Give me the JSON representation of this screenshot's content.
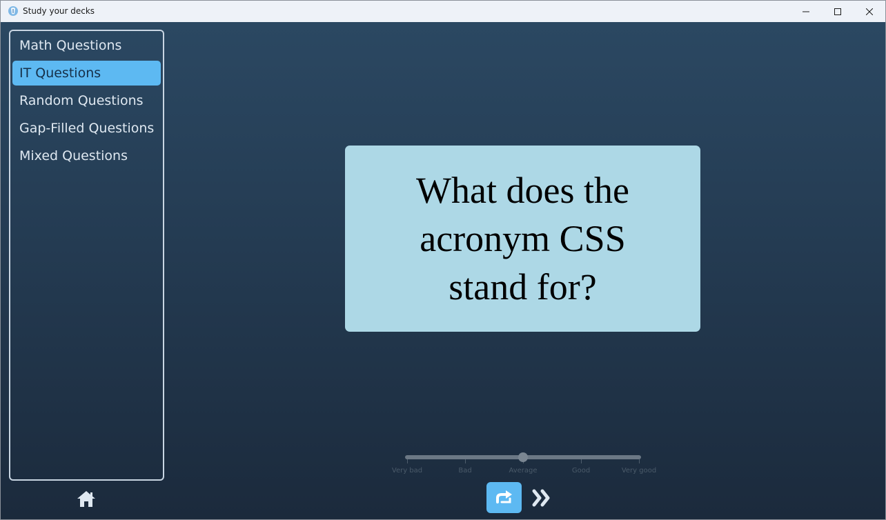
{
  "window": {
    "title": "Study your decks"
  },
  "sidebar": {
    "items": [
      {
        "label": "Math Questions",
        "selected": false
      },
      {
        "label": "IT Questions",
        "selected": true
      },
      {
        "label": "Random Questions",
        "selected": false
      },
      {
        "label": "Gap-Filled Questions",
        "selected": false
      },
      {
        "label": "Mixed Questions",
        "selected": false
      }
    ]
  },
  "card": {
    "question": "What does the acronym CSS stand for?"
  },
  "rating": {
    "labels": [
      "Very bad",
      "Bad",
      "Average",
      "Good",
      "Very good"
    ],
    "value": "Average"
  },
  "icons": {
    "home": "home-icon",
    "flip": "flip-icon",
    "next": "double-chevron-right-icon"
  },
  "colors": {
    "accent": "#5db9f2",
    "card": "#add8e6"
  }
}
